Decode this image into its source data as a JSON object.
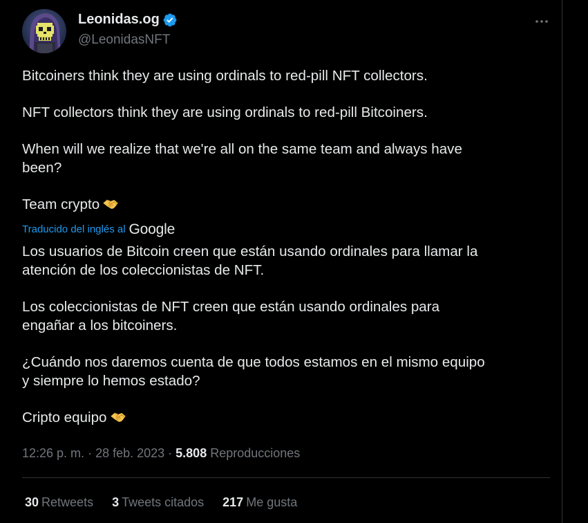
{
  "author": {
    "name": "Leonidas.og",
    "handle": "@LeonidasNFT",
    "verified_icon": "verified-badge-icon",
    "avatar_icon": "pixel-skull-avatar"
  },
  "more_icon": "more-horizontal-icon",
  "tweet": {
    "paragraphs": [
      "Bitcoiners think they are using ordinals to red-pill NFT collectors.",
      "NFT collectors think they are using ordinals to red-pill Bitcoiners.",
      "When will we realize that we're all on the same team and always have\nbeen?"
    ],
    "last_line": "Team crypto",
    "emoji": "handshake-emoji"
  },
  "translation": {
    "label": "Traducido del inglés al",
    "provider": "Google",
    "paragraphs": [
      "Los usuarios de Bitcoin creen que están usando ordinales para llamar la\natención de los coleccionistas de NFT.",
      "Los coleccionistas de NFT creen que están usando ordinales para\nengañar a los bitcoiners.",
      "¿Cuándo nos daremos cuenta de que todos estamos en el mismo equipo\ny siempre lo hemos estado?"
    ],
    "last_line": "Cripto equipo"
  },
  "meta": {
    "time": "12:26 p. m.",
    "sep1": " · ",
    "date": "28 feb. 2023",
    "sep2": " · ",
    "views_count": "5.808",
    "views_label": "Reproducciones"
  },
  "stats": {
    "retweets_count": "30",
    "retweets_label": "Retweets",
    "quotes_count": "3",
    "quotes_label": "Tweets citados",
    "likes_count": "217",
    "likes_label": "Me gusta"
  },
  "colors": {
    "background": "#000000",
    "text": "#e7e9ea",
    "secondary": "#71767b",
    "link": "#1d9bf0",
    "border": "#2f3336",
    "verified": "#1d9bf0"
  }
}
